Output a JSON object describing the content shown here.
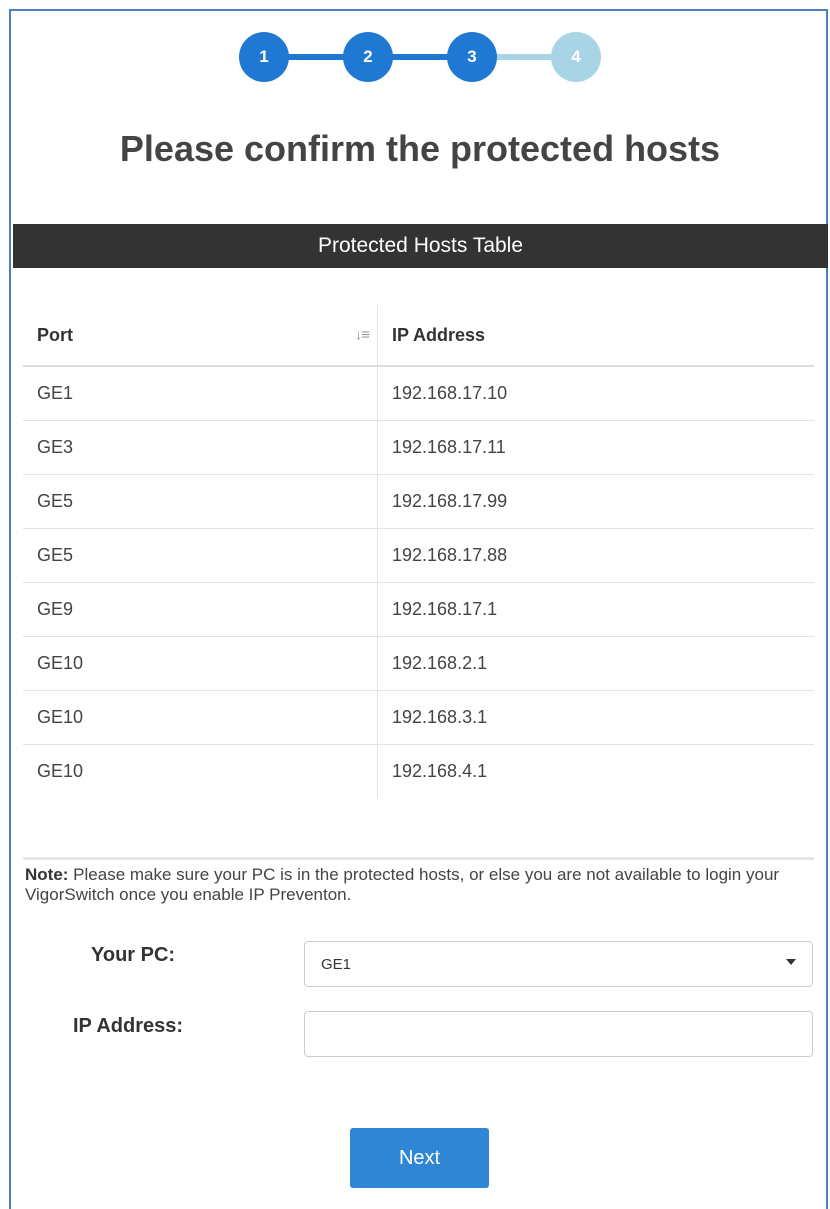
{
  "stepper": {
    "steps": [
      {
        "label": "1",
        "state": "done"
      },
      {
        "label": "2",
        "state": "done"
      },
      {
        "label": "3",
        "state": "current"
      },
      {
        "label": "4",
        "state": "pending"
      }
    ],
    "active_color": "#1f78d1",
    "pending_color": "#a8d4e6"
  },
  "title": "Please confirm the protected hosts",
  "table": {
    "caption": "Protected Hosts Table",
    "columns": [
      "Port",
      "IP Address"
    ],
    "sort_icon": "sort-descending-icon",
    "rows": [
      {
        "port": "GE1",
        "ip": "192.168.17.10"
      },
      {
        "port": "GE3",
        "ip": "192.168.17.11"
      },
      {
        "port": "GE5",
        "ip": "192.168.17.99"
      },
      {
        "port": "GE5",
        "ip": "192.168.17.88"
      },
      {
        "port": "GE9",
        "ip": "192.168.17.1"
      },
      {
        "port": "GE10",
        "ip": "192.168.2.1"
      },
      {
        "port": "GE10",
        "ip": "192.168.3.1"
      },
      {
        "port": "GE10",
        "ip": "192.168.4.1"
      }
    ]
  },
  "note": {
    "prefix": "Note:",
    "text": " Please make sure your PC is in the protected hosts, or else you are not available to login your VigorSwitch once you enable IP Preventon."
  },
  "form": {
    "your_pc_label": "Your PC:",
    "your_pc_value": "GE1",
    "ip_label": "IP Address:",
    "ip_value": ""
  },
  "next_button": "Next"
}
